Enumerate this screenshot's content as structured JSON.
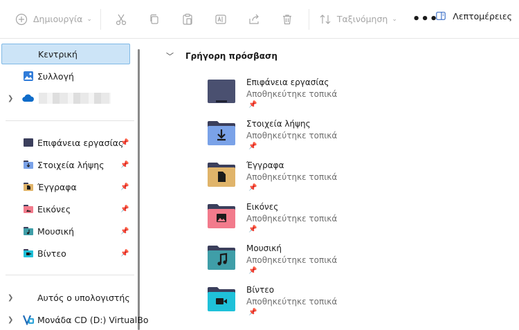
{
  "toolbar": {
    "new_label": "Δημιουργία",
    "sort_label": "Ταξινόμηση",
    "more_label": "•••",
    "details_label": "Λεπτομέρειες"
  },
  "sidebar": {
    "home": "Κεντρική",
    "gallery": "Συλλογή",
    "pinned": [
      {
        "label": "Επιφάνεια εργασίας",
        "icon": "desktop-folder-icon",
        "color": "#3b3f5c"
      },
      {
        "label": "Στοιχεία λήψης",
        "icon": "downloads-folder-icon",
        "color": "#7aa2e8"
      },
      {
        "label": "Έγγραφα",
        "icon": "documents-folder-icon",
        "color": "#e0b46a"
      },
      {
        "label": "Εικόνες",
        "icon": "pictures-folder-icon",
        "color": "#f27b8c"
      },
      {
        "label": "Μουσική",
        "icon": "music-folder-icon",
        "color": "#3f9ea8"
      },
      {
        "label": "Βίντεο",
        "icon": "videos-folder-icon",
        "color": "#1fc1d9"
      }
    ],
    "this_pc": "Αυτός ο υπολογιστής",
    "cd_drive": "Μονάδα CD (D:) VirtualBo"
  },
  "content": {
    "section_title": "Γρήγορη πρόσβαση",
    "items": [
      {
        "name": "Επιφάνεια εργασίας",
        "sub": "Αποθηκεύτηκε τοπικά",
        "icon": "desktop-folder-icon"
      },
      {
        "name": "Στοιχεία λήψης",
        "sub": "Αποθηκεύτηκε τοπικά",
        "icon": "downloads-folder-icon"
      },
      {
        "name": "Έγγραφα",
        "sub": "Αποθηκεύτηκε τοπικά",
        "icon": "documents-folder-icon"
      },
      {
        "name": "Εικόνες",
        "sub": "Αποθηκεύτηκε τοπικά",
        "icon": "pictures-folder-icon"
      },
      {
        "name": "Μουσική",
        "sub": "Αποθηκεύτηκε τοπικά",
        "icon": "music-folder-icon"
      },
      {
        "name": "Βίντεο",
        "sub": "Αποθηκεύτηκε τοπικά",
        "icon": "videos-folder-icon"
      }
    ]
  },
  "colors": {
    "selection_bg": "#cce4f7",
    "selection_border": "#7fb9e6",
    "folder_tab": "#3b3f5c"
  }
}
